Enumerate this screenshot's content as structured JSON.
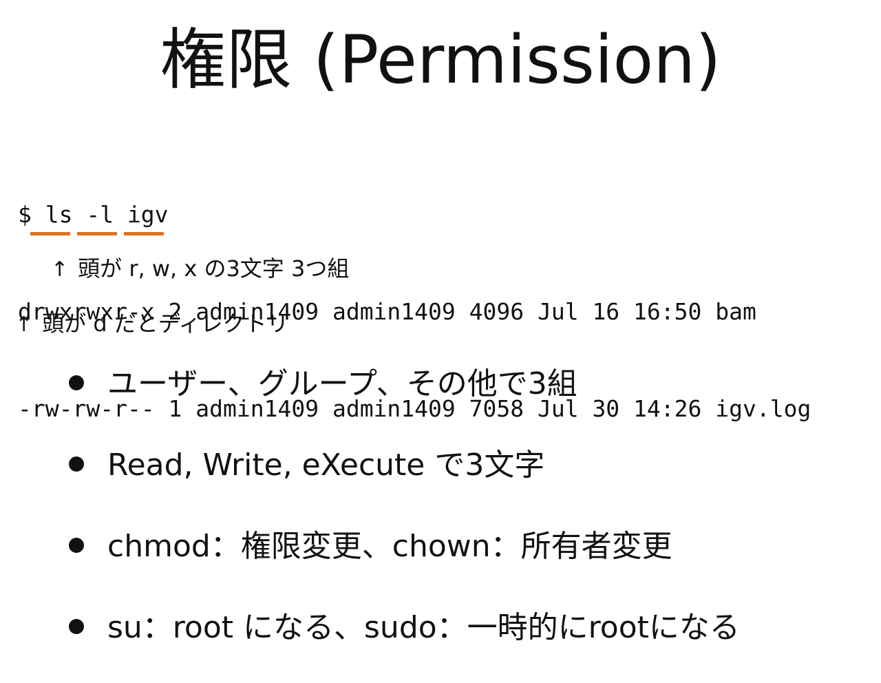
{
  "title": "権限 (Permission)",
  "terminal": {
    "lines": [
      "$ ls -l igv",
      "drwxrwxr-x 2 admin1409 admin1409 4096 Jul 16 16:50 bam",
      "-rw-rw-r-- 1 admin1409 admin1409 7058 Jul 30 14:26 igv.log"
    ]
  },
  "annotations": {
    "highlight_color": "#e07020",
    "arrow_glyph": "↑",
    "perm_note": "頭が r, w, x  の3文字 3つ組",
    "dir_note": "頭が d  だとディレクトリ"
  },
  "bullets": [
    "ユーザー、グループ、その他で3組",
    "Read, Write, eXecute  で3文字",
    "chmod：権限変更、chown：所有者変更",
    "su：root になる、sudo：一時的にrootになる"
  ]
}
